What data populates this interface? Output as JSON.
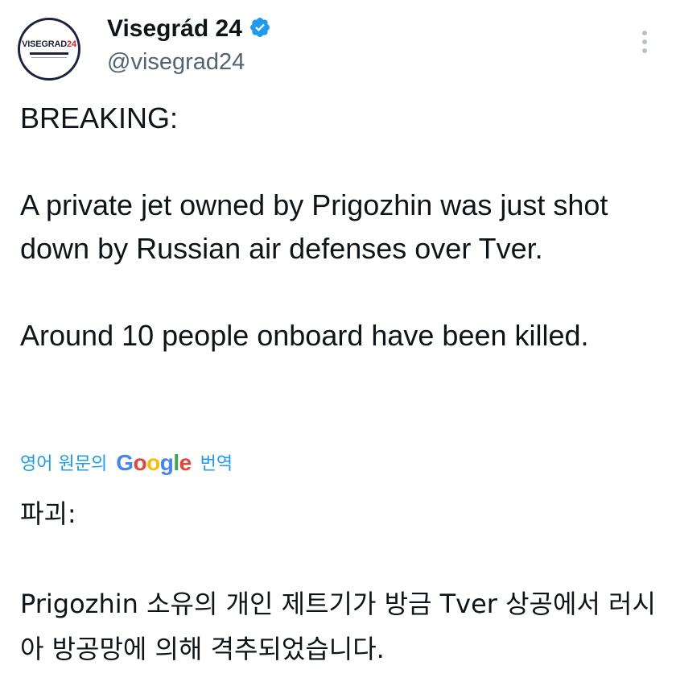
{
  "author": {
    "display_name": "Visegrád 24",
    "handle": "@visegrad24",
    "verified": true,
    "avatar_text_main": "VISEGRAD",
    "avatar_text_num": "24"
  },
  "tweet": {
    "lines": [
      "BREAKING:",
      "A private jet owned by Prigozhin was just shot down by Russian air defenses over Tver.",
      "Around 10 people onboard have been killed."
    ]
  },
  "translation": {
    "prefix": "영어 원문의",
    "logo_letters": [
      "G",
      "o",
      "o",
      "g",
      "l",
      "e"
    ],
    "suffix": "번역",
    "lines": [
      "파괴:",
      "Prigozhin 소유의 개인 제트기가 방금 Tver 상공에서 러시아 방공망에 의해 격추되었습니다."
    ]
  },
  "icons": {
    "verified": "verified-badge-icon",
    "more": "more-vertical-icon"
  },
  "colors": {
    "link": "#1d9bf0",
    "verified": "#1d9bf0",
    "secondary_text": "#536471"
  }
}
